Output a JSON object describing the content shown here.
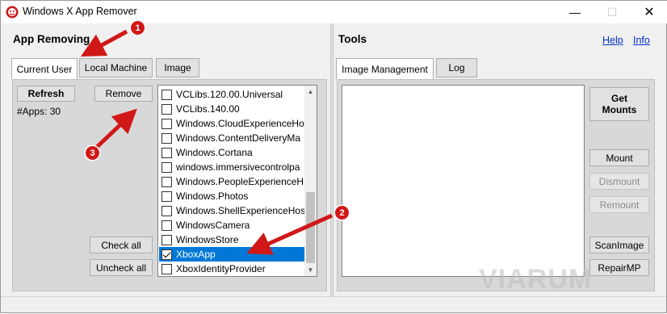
{
  "window": {
    "title": "Windows X App Remover"
  },
  "left": {
    "title": "App Removing",
    "tabs": [
      "Current User",
      "Local Machine",
      "Image"
    ],
    "refresh_label": "Refresh",
    "remove_label": "Remove",
    "apps_count": "#Apps: 30",
    "check_all_label": "Check all",
    "uncheck_all_label": "Uncheck all",
    "apps": [
      {
        "label": "VCLibs.120.00.Universal",
        "checked": false
      },
      {
        "label": "VCLibs.140.00",
        "checked": false
      },
      {
        "label": "Windows.CloudExperienceHo",
        "checked": false
      },
      {
        "label": "Windows.ContentDeliveryMa",
        "checked": false
      },
      {
        "label": "Windows.Cortana",
        "checked": false
      },
      {
        "label": "windows.immersivecontrolpa",
        "checked": false
      },
      {
        "label": "Windows.PeopleExperienceH",
        "checked": false
      },
      {
        "label": "Windows.Photos",
        "checked": false
      },
      {
        "label": "Windows.ShellExperienceHos",
        "checked": false
      },
      {
        "label": "WindowsCamera",
        "checked": false
      },
      {
        "label": "WindowsStore",
        "checked": false
      },
      {
        "label": "XboxApp",
        "checked": true,
        "selected": true
      },
      {
        "label": "XboxIdentityProvider",
        "checked": false
      }
    ]
  },
  "right": {
    "title": "Tools",
    "help_label": "Help",
    "info_label": "Info",
    "tabs": [
      "Image Management",
      "Log"
    ],
    "get_mounts_label": "Get\nMounts",
    "mount_label": "Mount",
    "dismount_label": "Dismount",
    "remount_label": "Remount",
    "scanimage_label": "ScanImage",
    "repairmp_label": "RepairMP"
  },
  "annotations": [
    "1",
    "2",
    "3"
  ],
  "watermark": "VIARUM",
  "colors": {
    "selection": "#0078d7",
    "annotation": "#d01818",
    "link": "#0033cc"
  }
}
